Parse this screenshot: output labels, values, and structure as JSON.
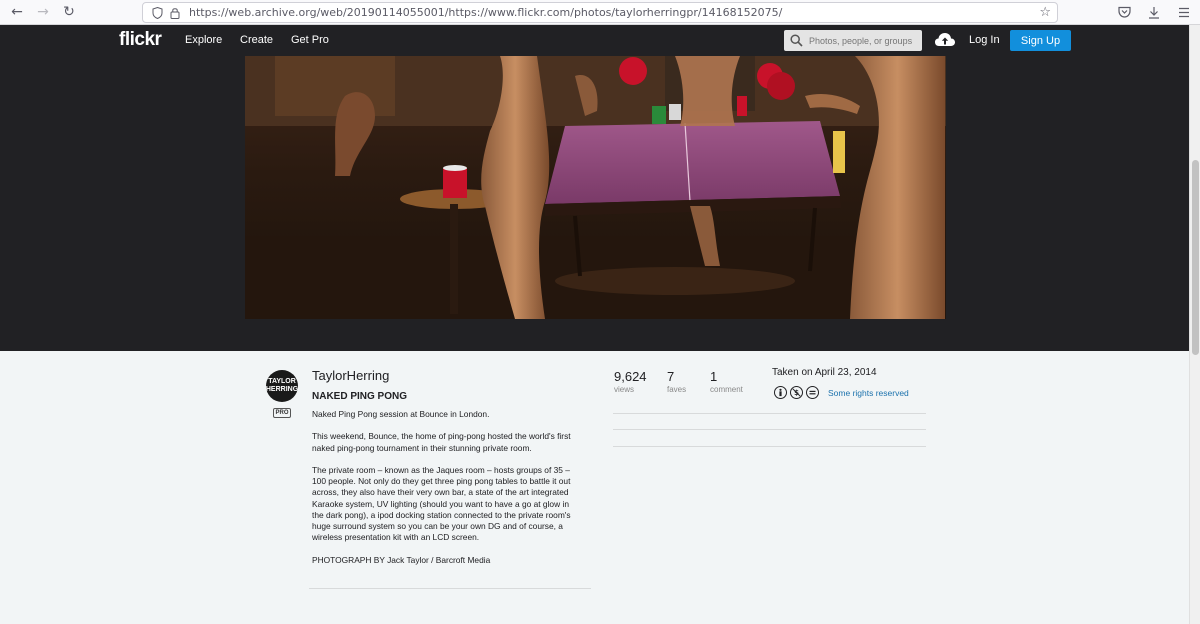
{
  "browser": {
    "url": "https://web.archive.org/web/20190114055001/https://www.flickr.com/photos/taylorherringpr/14168152075/"
  },
  "header": {
    "logo": "flickr",
    "nav": [
      "Explore",
      "Create",
      "Get Pro"
    ],
    "search_placeholder": "Photos, people, or groups",
    "login": "Log In",
    "signup": "Sign Up"
  },
  "owner": {
    "name": "TaylorHerring",
    "avatar_lines": [
      "TAYLOR",
      "HERRING"
    ],
    "badge": "PRO"
  },
  "photo": {
    "title": "NAKED PING PONG",
    "description": [
      "Naked Ping Pong session at Bounce in London.",
      "This weekend, Bounce, the home of ping-pong hosted the world's first naked ping-pong tournament in their stunning private room.",
      "The private room – known as the Jaques room – hosts groups of 35 – 100 people. Not only do they get three ping pong tables to battle it out across, they also have their very own bar, a state of the art integrated Karaoke system, UV lighting (should you want to have a go at glow in the dark pong), a ipod docking station connected to the private room's huge surround system so you can be your own DG and of course, a wireless presentation kit with an LCD screen.",
      "PHOTOGRAPH BY Jack Taylor / Barcroft Media"
    ]
  },
  "stats": {
    "views": {
      "value": "9,624",
      "label": "views"
    },
    "faves": {
      "value": "7",
      "label": "faves"
    },
    "comments": {
      "value": "1",
      "label": "comment"
    }
  },
  "meta": {
    "taken": "Taken on April 23, 2014",
    "license": "Some rights reserved",
    "license_icons": [
      "cc-by-icon",
      "cc-nc-icon",
      "cc-nd-icon"
    ]
  },
  "colors": {
    "header_bg": "#212124",
    "signup_blue": "#128fdc",
    "link_blue": "#1c72ad"
  }
}
